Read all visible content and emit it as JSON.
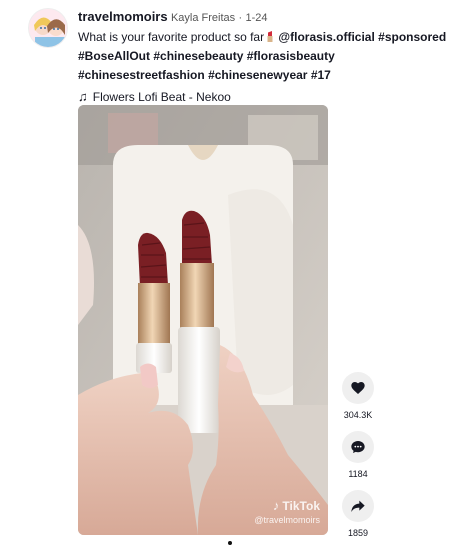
{
  "post": {
    "username": "travelmomoirs",
    "nickname": "Kayla Freitas",
    "separator": "·",
    "date": "1-24",
    "caption_text": "What is your favorite product so far",
    "caption_icon": "lipstick-emoji",
    "mention": "@florasis.official",
    "hashtags": [
      "#sponsored",
      "#BoseAllOut",
      "#chinesebeauty",
      "#florasisbeauty",
      "#chinesestreetfashion",
      "#chinesenewyear",
      "#17"
    ],
    "music": "Flowers Lofi Beat - Nekoo"
  },
  "video": {
    "watermark_brand": "TikTok",
    "watermark_handle": "@travelmomoirs"
  },
  "actions": {
    "likes": "304.3K",
    "comments": "1184",
    "shares": "1859"
  },
  "colors": {
    "lipstick": "#7a1f24",
    "gold": "#c9a27a",
    "tube": "#f4f1ec",
    "skin": "#e9c6b6"
  }
}
